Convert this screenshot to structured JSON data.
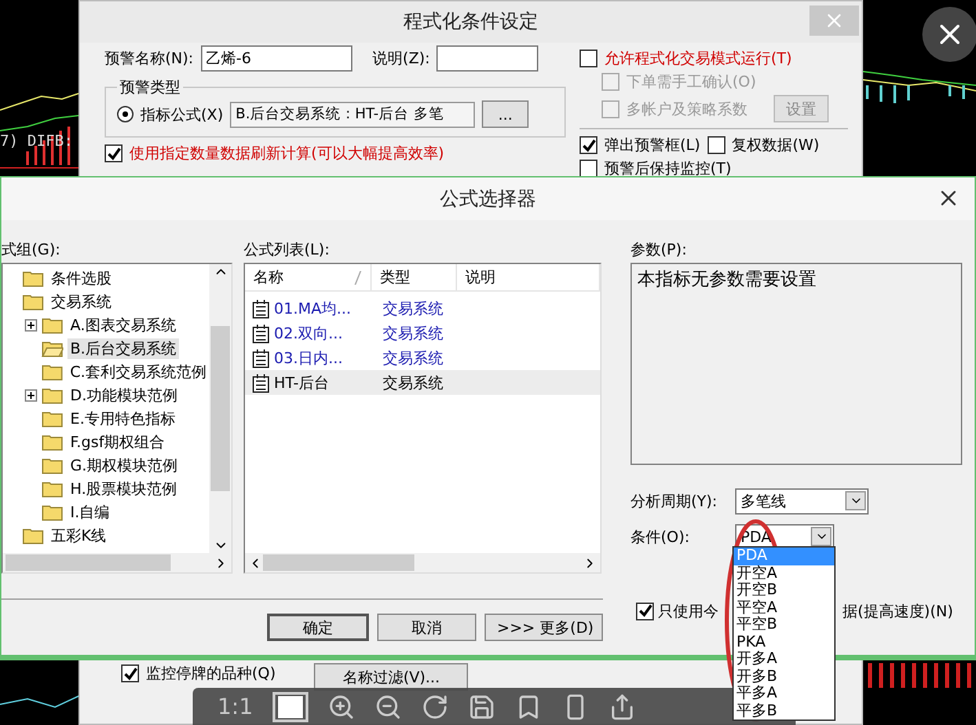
{
  "chart": {
    "label": "7) DIFB:"
  },
  "alert_dialog": {
    "title": "程式化条件设定",
    "name_label": "预警名称(N):",
    "name_value": "乙烯-6",
    "desc_label": "说明(Z):",
    "type_group": {
      "title": "预警类型",
      "options": [
        {
          "label": "指标公式(X)",
          "selected": true
        }
      ],
      "formula": "B.后台交易系统 : HT-后台 多笔",
      "browse_button": "..."
    },
    "refresh_option": {
      "label": "使用指定数量数据刷新计算(可以大幅提高效率)",
      "checked": true
    },
    "trade_options": [
      {
        "label": "允许程式化交易模式运行(T)",
        "checked": false,
        "disabled": false
      },
      {
        "label": "下单需手工确认(O)",
        "checked": false,
        "disabled": true
      },
      {
        "label": "多帐户及策略系数",
        "checked": false,
        "disabled": true
      }
    ],
    "settings_button": {
      "label": "设置",
      "disabled": true
    },
    "popup_options": [
      {
        "label": "弹出预警框(L)",
        "checked": true
      },
      {
        "label": "复权数据(W)",
        "checked": false
      }
    ],
    "keep_monitoring": {
      "label": "预警后保持监控(T)",
      "checked": false
    },
    "suspended_option": {
      "label": "监控停牌的品种(Q)",
      "checked": true
    },
    "filter_button": "名称过滤(V)..."
  },
  "formula_dialog": {
    "title": "公式选择器",
    "group_label": "式组(G):",
    "tree": [
      {
        "label": "条件选股",
        "selected": false
      },
      {
        "label": "交易系统",
        "selected": false,
        "children": [
          {
            "label": "A.图表交易系统",
            "selected": false,
            "expanded": false
          },
          {
            "label": "B.后台交易系统",
            "selected": true
          },
          {
            "label": "C.套利交易系统范例",
            "selected": false
          },
          {
            "label": "D.功能模块范例",
            "selected": false,
            "expanded": false
          },
          {
            "label": "E.专用特色指标",
            "selected": false
          },
          {
            "label": "F.gsf期权组合",
            "selected": false
          },
          {
            "label": "G.期权模块范例",
            "selected": false
          },
          {
            "label": "H.股票模块范例",
            "selected": false
          },
          {
            "label": "I.自编",
            "selected": false
          }
        ]
      },
      {
        "label": "五彩K线",
        "selected": false
      }
    ],
    "list_label": "公式列表(L):",
    "columns": [
      "名称",
      "类型",
      "说明"
    ],
    "rows": [
      {
        "name": "01.MA均...",
        "type": "交易系统",
        "color": "#1a1ab0",
        "selected": false
      },
      {
        "name": "02.双向...",
        "type": "交易系统",
        "color": "#1a1ab0",
        "selected": false
      },
      {
        "name": "03.日内...",
        "type": "交易系统",
        "color": "#1a1ab0",
        "selected": false
      },
      {
        "name": "HT-后台",
        "type": "交易系统",
        "color": "#000000",
        "selected": true
      }
    ],
    "params_label": "参数(P):",
    "params_text": "本指标无参数需要设置",
    "period_label": "分析周期(Y):",
    "period_value": "多笔线",
    "condition_label": "条件(O):",
    "condition_value": "PDA",
    "today_option": {
      "label_start": "只使用今",
      "label_end": "据(提高速度)(N)",
      "checked": true
    },
    "buttons": [
      "确定",
      "取消",
      ">>> 更多(D)"
    ]
  },
  "condition_dropdown": {
    "options": [
      {
        "label": "PDA",
        "selected": true
      },
      {
        "label": "开空A",
        "selected": false
      },
      {
        "label": "开空B",
        "selected": false
      },
      {
        "label": "平空A",
        "selected": false
      },
      {
        "label": "平空B",
        "selected": false
      },
      {
        "label": "PKA",
        "selected": false
      },
      {
        "label": "开多A",
        "selected": false
      },
      {
        "label": "开多B",
        "selected": false
      },
      {
        "label": "平多A",
        "selected": false
      },
      {
        "label": "平多B",
        "selected": false
      }
    ]
  },
  "viewer": {
    "zoom_label": "1:1"
  }
}
